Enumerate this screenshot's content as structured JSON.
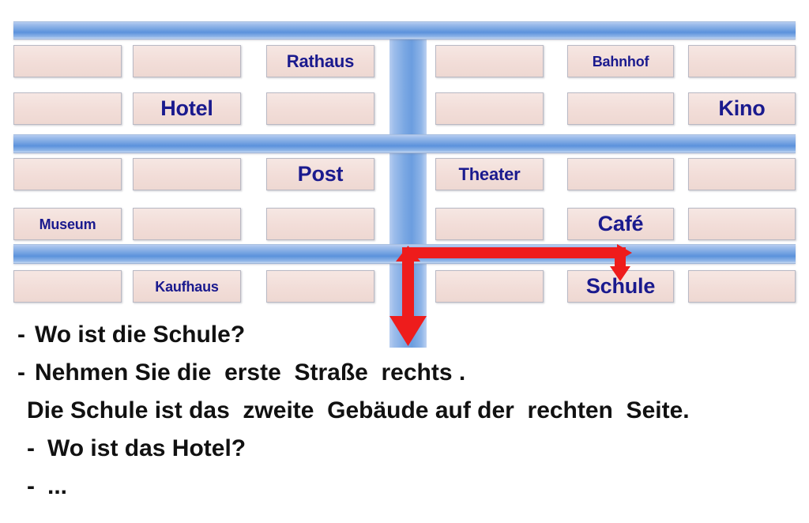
{
  "map": {
    "street_color": "#6f9fe0",
    "building_fill": "#f2ddd8",
    "building_border": "#b9b9c4",
    "label_color": "#1a1a8e",
    "route_color": "#ee1c1c",
    "rows": [
      {
        "row_id": "row-1",
        "blocks": [
          {
            "id": "b-1-1",
            "label": "",
            "size": "md"
          },
          {
            "id": "b-1-2",
            "label": "",
            "size": "md"
          },
          {
            "id": "b-1-3",
            "label": "Rathaus",
            "size": "md"
          },
          {
            "id": "b-1-4",
            "label": "",
            "size": "md"
          },
          {
            "id": "b-1-5",
            "label": "Bahnhof",
            "size": "sm"
          },
          {
            "id": "b-1-6",
            "label": "",
            "size": "md"
          }
        ]
      },
      {
        "row_id": "row-2",
        "blocks": [
          {
            "id": "b-2-1",
            "label": "",
            "size": "md"
          },
          {
            "id": "b-2-2",
            "label": "Hotel",
            "size": "lg"
          },
          {
            "id": "b-2-3",
            "label": "",
            "size": "md"
          },
          {
            "id": "b-2-4",
            "label": "",
            "size": "md"
          },
          {
            "id": "b-2-5",
            "label": "",
            "size": "md"
          },
          {
            "id": "b-2-6",
            "label": "Kino",
            "size": "lg"
          }
        ]
      },
      {
        "row_id": "row-3",
        "blocks": [
          {
            "id": "b-3-1",
            "label": "",
            "size": "md"
          },
          {
            "id": "b-3-2",
            "label": "",
            "size": "md"
          },
          {
            "id": "b-3-3",
            "label": "Post",
            "size": "lg"
          },
          {
            "id": "b-3-4",
            "label": "Theater",
            "size": "md"
          },
          {
            "id": "b-3-5",
            "label": "",
            "size": "md"
          },
          {
            "id": "b-3-6",
            "label": "",
            "size": "md"
          }
        ]
      },
      {
        "row_id": "row-4",
        "blocks": [
          {
            "id": "b-4-1",
            "label": "Museum",
            "size": "sm"
          },
          {
            "id": "b-4-2",
            "label": "",
            "size": "md"
          },
          {
            "id": "b-4-3",
            "label": "",
            "size": "md"
          },
          {
            "id": "b-4-4",
            "label": "",
            "size": "md"
          },
          {
            "id": "b-4-5",
            "label": "Café",
            "size": "lg"
          },
          {
            "id": "b-4-6",
            "label": "",
            "size": "md"
          }
        ]
      },
      {
        "row_id": "row-5",
        "blocks": [
          {
            "id": "b-5-1",
            "label": "",
            "size": "md"
          },
          {
            "id": "b-5-2",
            "label": "Kaufhaus",
            "size": "sm"
          },
          {
            "id": "b-5-3",
            "label": "",
            "size": "md"
          },
          {
            "id": "b-5-4",
            "label": "",
            "size": "md"
          },
          {
            "id": "b-5-5",
            "label": "Schule",
            "size": "lg"
          },
          {
            "id": "b-5-6",
            "label": "",
            "size": "md"
          }
        ]
      }
    ]
  },
  "dialogue": {
    "lines": [
      {
        "id": "line-1",
        "dash": "-",
        "text": "Wo ist die Schule?"
      },
      {
        "id": "line-2",
        "dash": "-",
        "text": "Nehmen Sie die  erste  Straße  rechts ."
      },
      {
        "id": "line-3",
        "dash": "",
        "text": "Die Schule ist das  zweite  Gebäude auf der  rechten  Seite."
      },
      {
        "id": "line-4",
        "dash": "-",
        "text": "Wo ist das Hotel?"
      },
      {
        "id": "line-5",
        "dash": "-",
        "text": "..."
      }
    ]
  }
}
